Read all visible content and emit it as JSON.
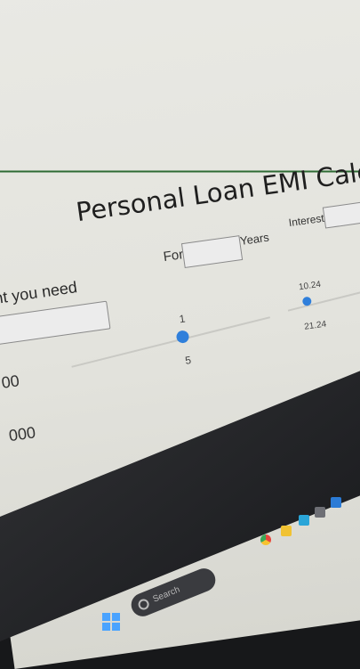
{
  "page": {
    "title": "Personal Loan EMI Calculator"
  },
  "loan_amount": {
    "label": "nt you need",
    "slider_min_fragment": "00",
    "slider_max_fragment": "000"
  },
  "tenure": {
    "label_prefix": "For",
    "label_suffix": "Years",
    "slider_min": "1",
    "slider_max": "5"
  },
  "interest": {
    "label": "Interest",
    "slider_min": "10.24",
    "slider_max": "21.24"
  },
  "taskbar": {
    "search_placeholder": "Search",
    "icons": [
      "windows-start-icon",
      "search-icon",
      "chrome-icon",
      "folder-icon",
      "edge-icon",
      "store-icon",
      "app-icon"
    ]
  },
  "colors": {
    "accent": "#2f7fdb",
    "rule": "#2e6b34"
  }
}
